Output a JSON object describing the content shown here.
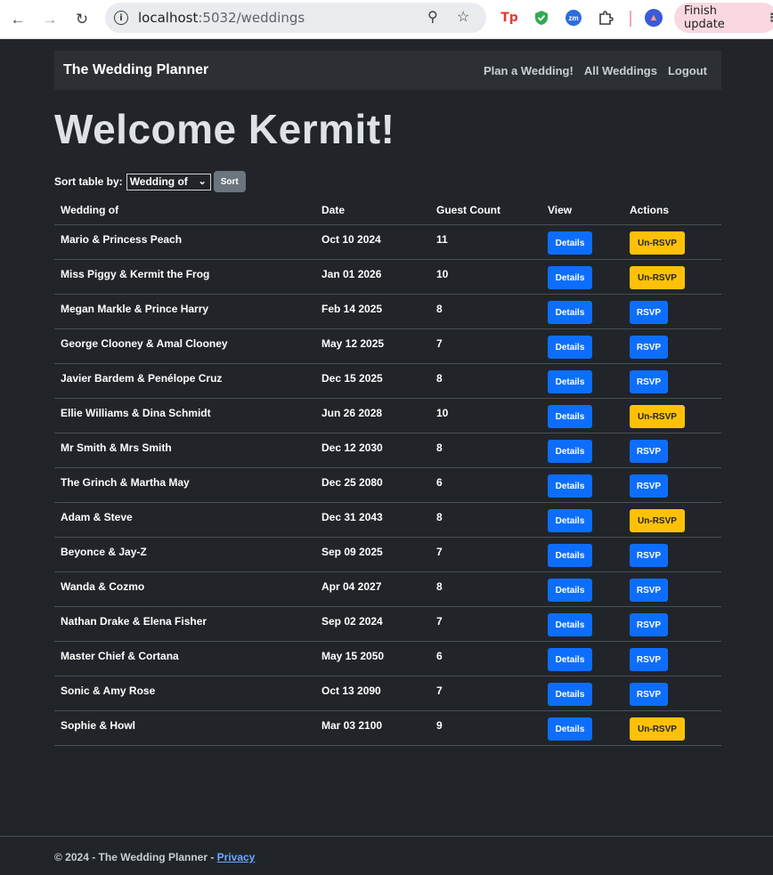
{
  "browser": {
    "url_host": "localhost",
    "url_port_path": ":5032/weddings",
    "finish_update": "Finish update"
  },
  "navbar": {
    "brand": "The Wedding Planner",
    "links": [
      "Plan a Wedding!",
      "All Weddings",
      "Logout"
    ]
  },
  "welcome": "Welcome Kermit!",
  "sort": {
    "label": "Sort table by:",
    "selected": "Wedding of",
    "button": "Sort"
  },
  "table": {
    "headers": [
      "Wedding of",
      "Date",
      "Guest Count",
      "View",
      "Actions"
    ],
    "details_label": "Details",
    "rows": [
      {
        "couple": "Mario & Princess Peach",
        "date": "Oct 10 2024",
        "guests": "11",
        "action": "Un-RSVP"
      },
      {
        "couple": "Miss Piggy & Kermit the Frog",
        "date": "Jan 01 2026",
        "guests": "10",
        "action": "Un-RSVP"
      },
      {
        "couple": "Megan Markle & Prince Harry",
        "date": "Feb 14 2025",
        "guests": "8",
        "action": "RSVP"
      },
      {
        "couple": "George Clooney & Amal Clooney",
        "date": "May 12 2025",
        "guests": "7",
        "action": "RSVP"
      },
      {
        "couple": "Javier Bardem & Penélope Cruz",
        "date": "Dec 15 2025",
        "guests": "8",
        "action": "RSVP"
      },
      {
        "couple": "Ellie Williams & Dina Schmidt",
        "date": "Jun 26 2028",
        "guests": "10",
        "action": "Un-RSVP"
      },
      {
        "couple": "Mr Smith & Mrs Smith",
        "date": "Dec 12 2030",
        "guests": "8",
        "action": "RSVP"
      },
      {
        "couple": "The Grinch & Martha May",
        "date": "Dec 25 2080",
        "guests": "6",
        "action": "RSVP"
      },
      {
        "couple": "Adam & Steve",
        "date": "Dec 31 2043",
        "guests": "8",
        "action": "Un-RSVP"
      },
      {
        "couple": "Beyonce & Jay-Z",
        "date": "Sep 09 2025",
        "guests": "7",
        "action": "RSVP"
      },
      {
        "couple": "Wanda & Cozmo",
        "date": "Apr 04 2027",
        "guests": "8",
        "action": "RSVP"
      },
      {
        "couple": "Nathan Drake & Elena Fisher",
        "date": "Sep 02 2024",
        "guests": "7",
        "action": "RSVP"
      },
      {
        "couple": "Master Chief & Cortana",
        "date": "May 15 2050",
        "guests": "6",
        "action": "RSVP"
      },
      {
        "couple": "Sonic & Amy Rose",
        "date": "Oct 13 2090",
        "guests": "7",
        "action": "RSVP"
      },
      {
        "couple": "Sophie & Howl",
        "date": "Mar 03 2100",
        "guests": "9",
        "action": "Un-RSVP"
      }
    ]
  },
  "footer": {
    "text": "© 2024 - The Wedding Planner - ",
    "privacy": "Privacy"
  },
  "colors": {
    "background": "#212529",
    "primary": "#0d6efd",
    "warning": "#ffc107",
    "secondary": "#6c757d"
  }
}
